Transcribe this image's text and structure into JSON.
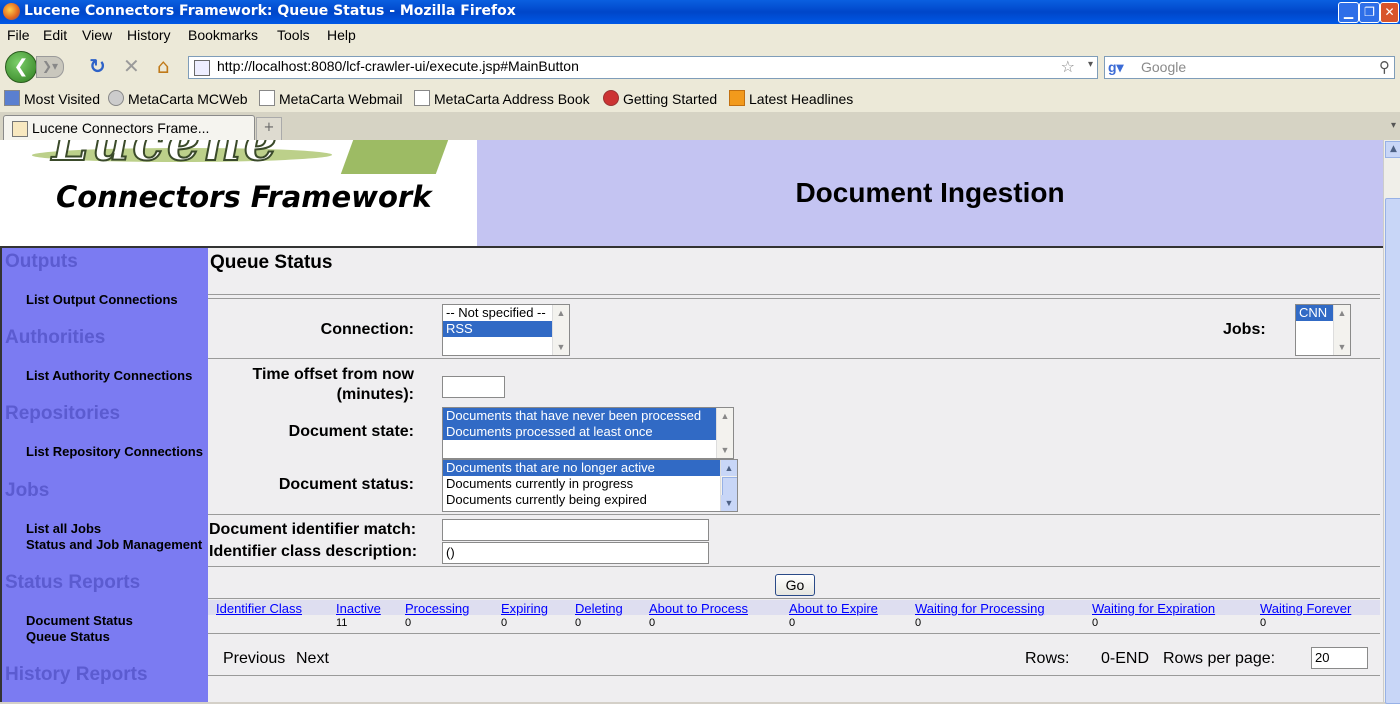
{
  "window": {
    "title": "Lucene Connectors Framework: Queue Status - Mozilla Firefox"
  },
  "menu": [
    "File",
    "Edit",
    "View",
    "History",
    "Bookmarks",
    "Tools",
    "Help"
  ],
  "url": "http://localhost:8080/lcf-crawler-ui/execute.jsp#MainButton",
  "search": {
    "placeholder": "Google"
  },
  "bookmarks": [
    "Most Visited",
    "MetaCarta MCWeb",
    "MetaCarta Webmail",
    "MetaCarta Address Book",
    "Getting Started",
    "Latest Headlines"
  ],
  "tab": {
    "title": "Lucene Connectors Frame..."
  },
  "header": {
    "logo_word": "Lucene",
    "logo_sub": "Connectors Framework",
    "banner": "Document Ingestion"
  },
  "nav": {
    "sections": [
      {
        "title": "Outputs",
        "links": [
          "List Output Connections"
        ]
      },
      {
        "title": "Authorities",
        "links": [
          "List Authority Connections"
        ]
      },
      {
        "title": "Repositories",
        "links": [
          "List Repository Connections"
        ]
      },
      {
        "title": "Jobs",
        "links": [
          "List all Jobs",
          "Status and Job Management"
        ]
      },
      {
        "title": "Status Reports",
        "links": [
          "Document Status",
          "Queue Status"
        ]
      },
      {
        "title": "History Reports",
        "links": []
      }
    ]
  },
  "main": {
    "title": "Queue Status",
    "connection_label": "Connection:",
    "connection_options": [
      {
        "label": "-- Not specified --",
        "selected": false
      },
      {
        "label": "RSS",
        "selected": true
      }
    ],
    "jobs_label": "Jobs:",
    "jobs_options": [
      {
        "label": "CNN",
        "selected": true
      }
    ],
    "time_offset_label_1": "Time offset from now",
    "time_offset_label_2": "(minutes):",
    "time_offset_value": "",
    "doc_state_label": "Document state:",
    "doc_state_options": [
      {
        "label": "Documents that have never been processed",
        "selected": true
      },
      {
        "label": "Documents processed at least once",
        "selected": true
      }
    ],
    "doc_status_label": "Document status:",
    "doc_status_options": [
      {
        "label": "Documents that are no longer active",
        "selected": true
      },
      {
        "label": "Documents currently in progress",
        "selected": false
      },
      {
        "label": "Documents currently being expired",
        "selected": false
      }
    ],
    "id_match_label": "Document identifier match:",
    "id_match_value": "",
    "id_class_label": "Identifier class description:",
    "id_class_value": "()",
    "go_label": "Go",
    "table": {
      "headers": [
        "Identifier Class",
        "Inactive",
        "Processing",
        "Expiring",
        "Deleting",
        "About to Process",
        "About to Expire",
        "Waiting for Processing",
        "Waiting for Expiration",
        "Waiting Forever"
      ],
      "row": [
        "",
        "11",
        "0",
        "0",
        "0",
        "0",
        "0",
        "0",
        "0",
        "0"
      ]
    },
    "pager": {
      "previous": "Previous",
      "next": "Next",
      "rows_label": "Rows:",
      "rows_value": "0-END",
      "rows_per_page_label": "Rows per page:",
      "rows_per_page_value": "20"
    }
  },
  "colors": {
    "nav_bg": "#7b7bf2",
    "banner_bg": "#c4c4f2",
    "selection": "#316ac5"
  }
}
